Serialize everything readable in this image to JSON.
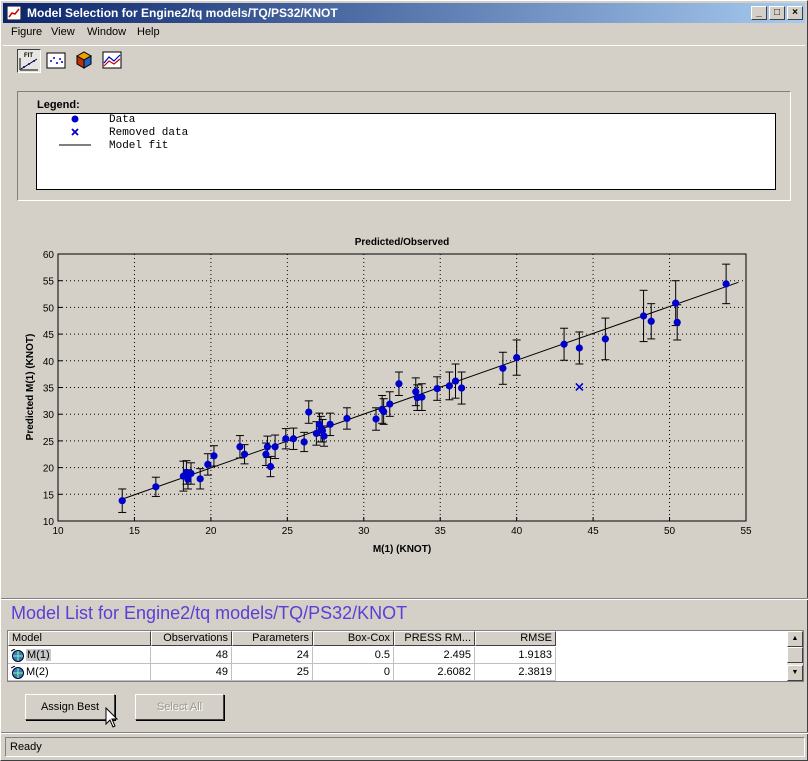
{
  "window": {
    "title": "Model Selection for Engine2/tq models/TQ/PS32/KNOT",
    "controls": {
      "minimize": "_",
      "maximize": "□",
      "close": "×"
    }
  },
  "menu": [
    "Figure",
    "View",
    "Window",
    "Help"
  ],
  "toolbar": {
    "tools": [
      {
        "name": "fit-tool-icon",
        "label": "FIT",
        "active": true
      },
      {
        "name": "residuals-tool-icon",
        "active": false
      },
      {
        "name": "cube-tool-icon",
        "active": false
      },
      {
        "name": "cross-section-tool-icon",
        "active": false
      }
    ]
  },
  "legend": {
    "title": "Legend:",
    "items": [
      {
        "symbol": "dot",
        "label": "Data"
      },
      {
        "symbol": "cross",
        "label": "Removed data"
      },
      {
        "symbol": "line",
        "label": "Model fit"
      }
    ]
  },
  "chart_data": {
    "type": "scatter",
    "title": "Predicted/Observed",
    "xlabel": "M(1) (KNOT)",
    "ylabel": "Predicted M(1) (KNOT)",
    "xlim": [
      10,
      55
    ],
    "ylim": [
      10,
      60
    ],
    "xticks": [
      10,
      15,
      20,
      25,
      30,
      35,
      40,
      45,
      50,
      55
    ],
    "yticks": [
      10,
      15,
      20,
      25,
      30,
      35,
      40,
      45,
      50,
      55,
      60
    ],
    "grid": true,
    "colors": {
      "data": "#0000cc",
      "removed": "#0000cc",
      "fit": "#000000",
      "errorbar": "#000000"
    },
    "fit_line": {
      "x": [
        14,
        54.5
      ],
      "y": [
        13.9,
        54.7
      ]
    },
    "series": [
      {
        "name": "Data",
        "points": [
          {
            "x": 14.2,
            "y": 13.8,
            "err": 2.2
          },
          {
            "x": 16.4,
            "y": 16.4,
            "err": 1.8
          },
          {
            "x": 18.2,
            "y": 18.4,
            "err": 2.8
          },
          {
            "x": 18.4,
            "y": 19.1,
            "err": 2.2
          },
          {
            "x": 18.5,
            "y": 17.8,
            "err": 1.8
          },
          {
            "x": 18.7,
            "y": 18.9,
            "err": 2.0
          },
          {
            "x": 19.3,
            "y": 17.9,
            "err": 1.9
          },
          {
            "x": 19.8,
            "y": 20.6,
            "err": 2.0
          },
          {
            "x": 20.2,
            "y": 22.2,
            "err": 1.9
          },
          {
            "x": 21.9,
            "y": 23.9,
            "err": 2.1
          },
          {
            "x": 22.2,
            "y": 22.5,
            "err": 1.8
          },
          {
            "x": 23.6,
            "y": 22.5,
            "err": 2.1
          },
          {
            "x": 23.7,
            "y": 23.9,
            "err": 2.0
          },
          {
            "x": 23.9,
            "y": 20.2,
            "err": 1.9
          },
          {
            "x": 24.2,
            "y": 23.9,
            "err": 2.2
          },
          {
            "x": 24.9,
            "y": 25.4,
            "err": 1.9
          },
          {
            "x": 25.4,
            "y": 25.4,
            "err": 2.0
          },
          {
            "x": 26.1,
            "y": 24.8,
            "err": 1.8
          },
          {
            "x": 26.4,
            "y": 30.4,
            "err": 2.1
          },
          {
            "x": 26.9,
            "y": 26.4,
            "err": 2.2
          },
          {
            "x": 27.1,
            "y": 28.1,
            "err": 2.1
          },
          {
            "x": 27.2,
            "y": 27.2,
            "err": 2.4
          },
          {
            "x": 27.3,
            "y": 26.9,
            "err": 2.1
          },
          {
            "x": 27.4,
            "y": 25.9,
            "err": 1.9
          },
          {
            "x": 27.8,
            "y": 28.1,
            "err": 2.1
          },
          {
            "x": 28.9,
            "y": 29.2,
            "err": 2.0
          },
          {
            "x": 30.8,
            "y": 29.1,
            "err": 2.1
          },
          {
            "x": 31.2,
            "y": 30.9,
            "err": 2.6
          },
          {
            "x": 31.3,
            "y": 30.5,
            "err": 2.4
          },
          {
            "x": 31.7,
            "y": 31.9,
            "err": 2.3
          },
          {
            "x": 32.3,
            "y": 35.7,
            "err": 2.2
          },
          {
            "x": 33.4,
            "y": 34.2,
            "err": 2.6
          },
          {
            "x": 33.5,
            "y": 33.1,
            "err": 2.4
          },
          {
            "x": 33.8,
            "y": 33.2,
            "err": 2.5
          },
          {
            "x": 34.8,
            "y": 34.8,
            "err": 2.2
          },
          {
            "x": 35.6,
            "y": 35.3,
            "err": 2.6
          },
          {
            "x": 36.0,
            "y": 36.2,
            "err": 3.2
          },
          {
            "x": 36.4,
            "y": 34.9,
            "err": 3.0
          },
          {
            "x": 39.1,
            "y": 38.6,
            "err": 3.0
          },
          {
            "x": 40.0,
            "y": 40.6,
            "err": 3.3
          },
          {
            "x": 43.1,
            "y": 43.1,
            "err": 3.0
          },
          {
            "x": 44.1,
            "y": 42.4,
            "err": 3.0
          },
          {
            "x": 45.8,
            "y": 44.1,
            "err": 3.9
          },
          {
            "x": 48.3,
            "y": 48.4,
            "err": 4.8
          },
          {
            "x": 48.8,
            "y": 47.4,
            "err": 3.3
          },
          {
            "x": 50.4,
            "y": 50.8,
            "err": 4.2
          },
          {
            "x": 50.5,
            "y": 47.2,
            "err": 3.3
          },
          {
            "x": 53.7,
            "y": 54.4,
            "err": 3.7
          }
        ]
      },
      {
        "name": "Removed data",
        "points": [
          {
            "x": 44.1,
            "y": 35.1
          }
        ]
      }
    ]
  },
  "model_list": {
    "title": "Model List for Engine2/tq models/TQ/PS32/KNOT",
    "columns": [
      "Model",
      "Observations",
      "Parameters",
      "Box-Cox",
      "PRESS RM...",
      "RMSE"
    ],
    "rows": [
      [
        "M(1)",
        "48",
        "24",
        "0.5",
        "2.495",
        "1.9183"
      ],
      [
        "M(2)",
        "49",
        "25",
        "0",
        "2.6082",
        "2.3819"
      ]
    ],
    "selected_row": 0
  },
  "buttons": {
    "assign_best": "Assign Best",
    "select_all": "Select All"
  },
  "status": "Ready"
}
